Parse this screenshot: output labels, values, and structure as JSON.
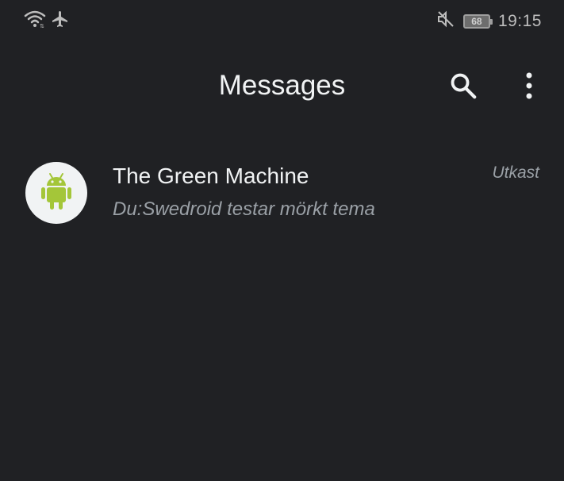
{
  "status_bar": {
    "time": "19:15",
    "battery_level": "68",
    "icons": [
      "wifi-icon",
      "airplane-mode-icon",
      "mute-icon",
      "battery-icon"
    ]
  },
  "app_bar": {
    "title": "Messages",
    "search_icon": "search-icon",
    "more_icon": "more-vert-icon"
  },
  "conversations": [
    {
      "name": "The Green Machine",
      "snippet": "Du:Swedroid testar mörkt tema",
      "meta": "Utkast",
      "avatar_icon": "android-icon",
      "avatar_color": "#a4c639"
    }
  ],
  "colors": {
    "background": "#202124",
    "primary_text": "#f1f3f4",
    "secondary_text": "#9aa0a6",
    "android_green": "#a4c639"
  }
}
